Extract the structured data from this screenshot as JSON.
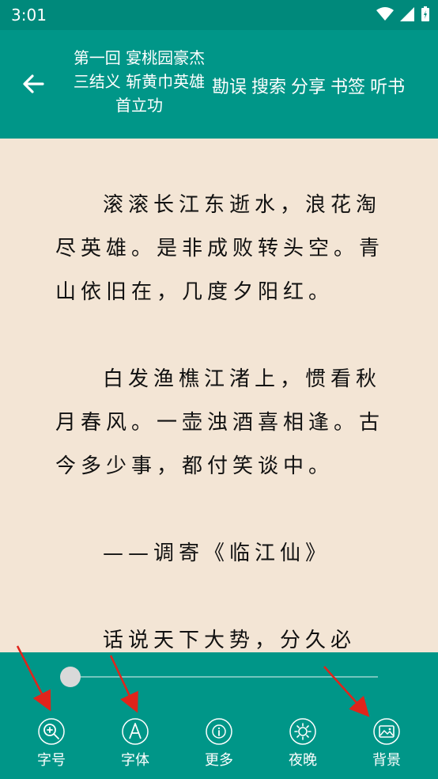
{
  "status": {
    "time": "3:01"
  },
  "header": {
    "title_lines": [
      "第一回 宴桃园豪杰",
      "三结义 斩黄巾英雄",
      "首立功"
    ],
    "actions": [
      "勘误",
      "搜索",
      "分享",
      "书签",
      "听书"
    ]
  },
  "content": {
    "paragraphs": [
      "滚滚长江东逝水，浪花淘尽英雄。是非成败转头空。青山依旧在，几度夕阳红。",
      "白发渔樵江渚上，惯看秋月春风。一壶浊酒喜相逢。古今多少事，都付笑谈中。",
      "——调寄《临江仙》",
      "话说天下大势，分久必"
    ]
  },
  "bottom_bar": {
    "slider_value": 0,
    "menu": [
      "字号",
      "字体",
      "更多",
      "夜晚",
      "背景"
    ]
  },
  "colors": {
    "primary": "#009688",
    "page_bg": "#f3e5d5",
    "annotation": "#e0241b"
  }
}
